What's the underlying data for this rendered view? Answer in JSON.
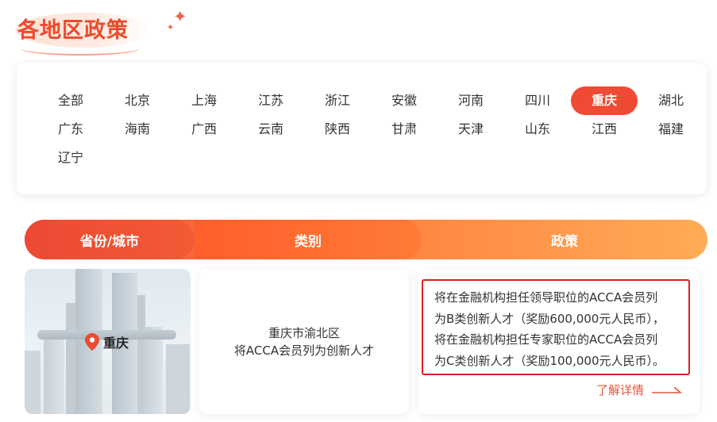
{
  "section_title": "各地区政策",
  "regions": [
    "全部",
    "北京",
    "上海",
    "江苏",
    "浙江",
    "安徽",
    "河南",
    "四川",
    "重庆",
    "湖北",
    "广东",
    "海南",
    "广西",
    "云南",
    "陕西",
    "甘肃",
    "天津",
    "山东",
    "江西",
    "福建",
    "辽宁"
  ],
  "active_region": "重庆",
  "table_header": {
    "col1": "省份/城市",
    "col2": "类别",
    "col3": "政策"
  },
  "row": {
    "city": "重庆",
    "category_line1": "重庆市渝北区",
    "category_line2": "将ACCA会员列为创新人才",
    "policy_lines": [
      "将在金融机构担任领导职位的ACCA会员列",
      "为B类创新人才（奖励600,000元人民币），",
      "将在金融机构担任专家职位的ACCA会员列",
      "为C类创新人才（奖励100,000元人民币）。"
    ],
    "more_link": "了解详情"
  },
  "colors": {
    "accent": "#ef4a33",
    "highlight_border": "#e02020"
  },
  "icons": {
    "location": "map-pin-icon",
    "arrow": "arrow-right-icon",
    "sparkle": "sparkle-icon"
  }
}
